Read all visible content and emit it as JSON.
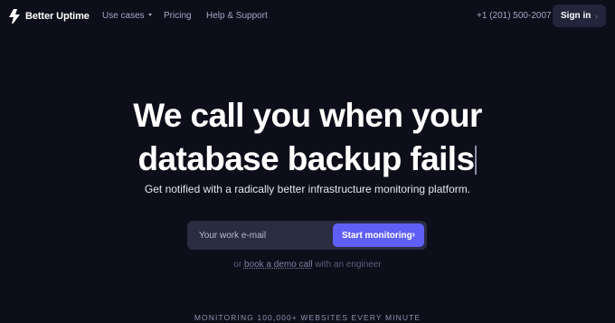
{
  "brand": {
    "name": "Better Uptime",
    "logo_icon": "lightning-bolt-icon"
  },
  "nav": {
    "use_cases": "Use cases",
    "pricing": "Pricing",
    "help": "Help & Support",
    "phone": "+1 (201) 500-2007",
    "sign_in": "Sign in",
    "sign_in_icon": "chevron-right-icon"
  },
  "hero": {
    "headline_line1": "We call you when your",
    "headline_line2": "database backup fails",
    "subheadline": "Get notified with a radically better infrastructure monitoring platform."
  },
  "signup": {
    "email_placeholder": "Your work e-mail",
    "email_value": "",
    "button_label": "Start monitoring",
    "button_icon": "chevron-right-icon"
  },
  "demo": {
    "prefix": "or",
    "link_text": "book a demo call",
    "suffix": "with an engineer"
  },
  "stats": {
    "monitoring_text": "MONITORING 100,000+ WEBSITES EVERY MINUTE"
  },
  "colors": {
    "background": "#0d0e1a",
    "accent": "#5f5ff6",
    "nav_text": "#a3a7c2"
  }
}
